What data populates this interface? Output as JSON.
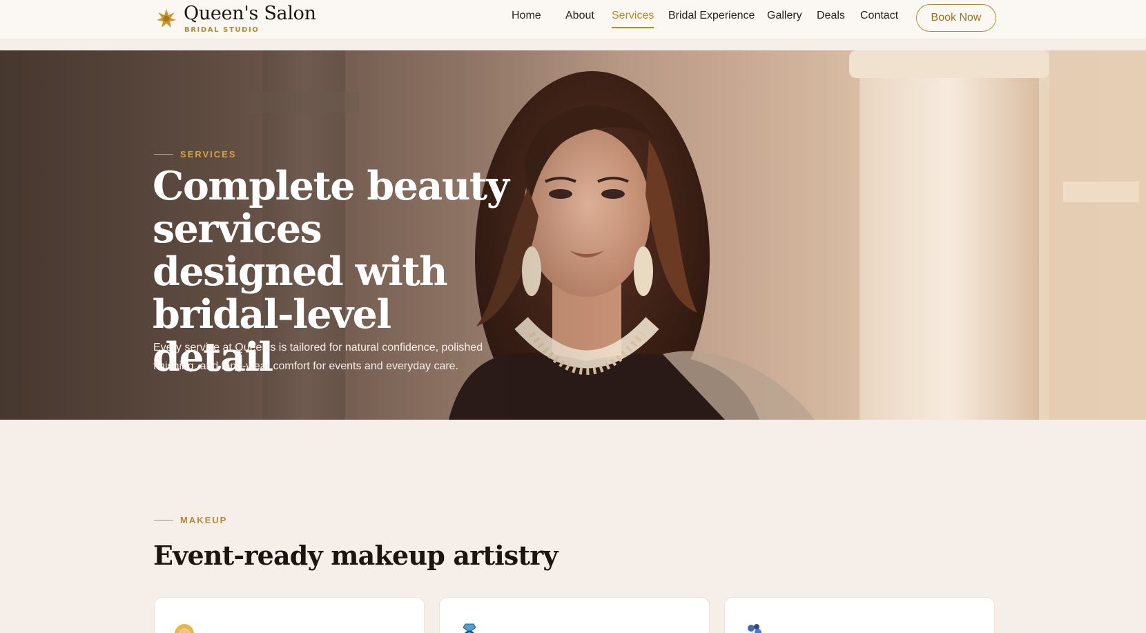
{
  "nav": {
    "brand_name": "Queen's Salon",
    "brand_sub": "BRIDAL STUDIO",
    "links": [
      "Home",
      "About",
      "Services",
      "Bridal Experience",
      "Gallery",
      "Deals",
      "Contact"
    ],
    "active": "Services",
    "cta": "Book Now"
  },
  "hero": {
    "eyebrow": "SERVICES",
    "title": "Complete beauty services designed with bridal-level detail",
    "description": "Every service at Queen's is tailored for natural confidence, polished finishing, and long-wear comfort for events and everyday care."
  },
  "makeup": {
    "eyebrow": "MAKEUP",
    "title": "Event-ready makeup artistry",
    "cards": [
      {
        "icon": "bride-icon"
      },
      {
        "icon": "ring-icon"
      },
      {
        "icon": "bouquet-icon"
      }
    ]
  },
  "colors": {
    "accent": "#b58a2a",
    "page_bg": "#f6eee8",
    "nav_bg": "#fbf8f4"
  }
}
